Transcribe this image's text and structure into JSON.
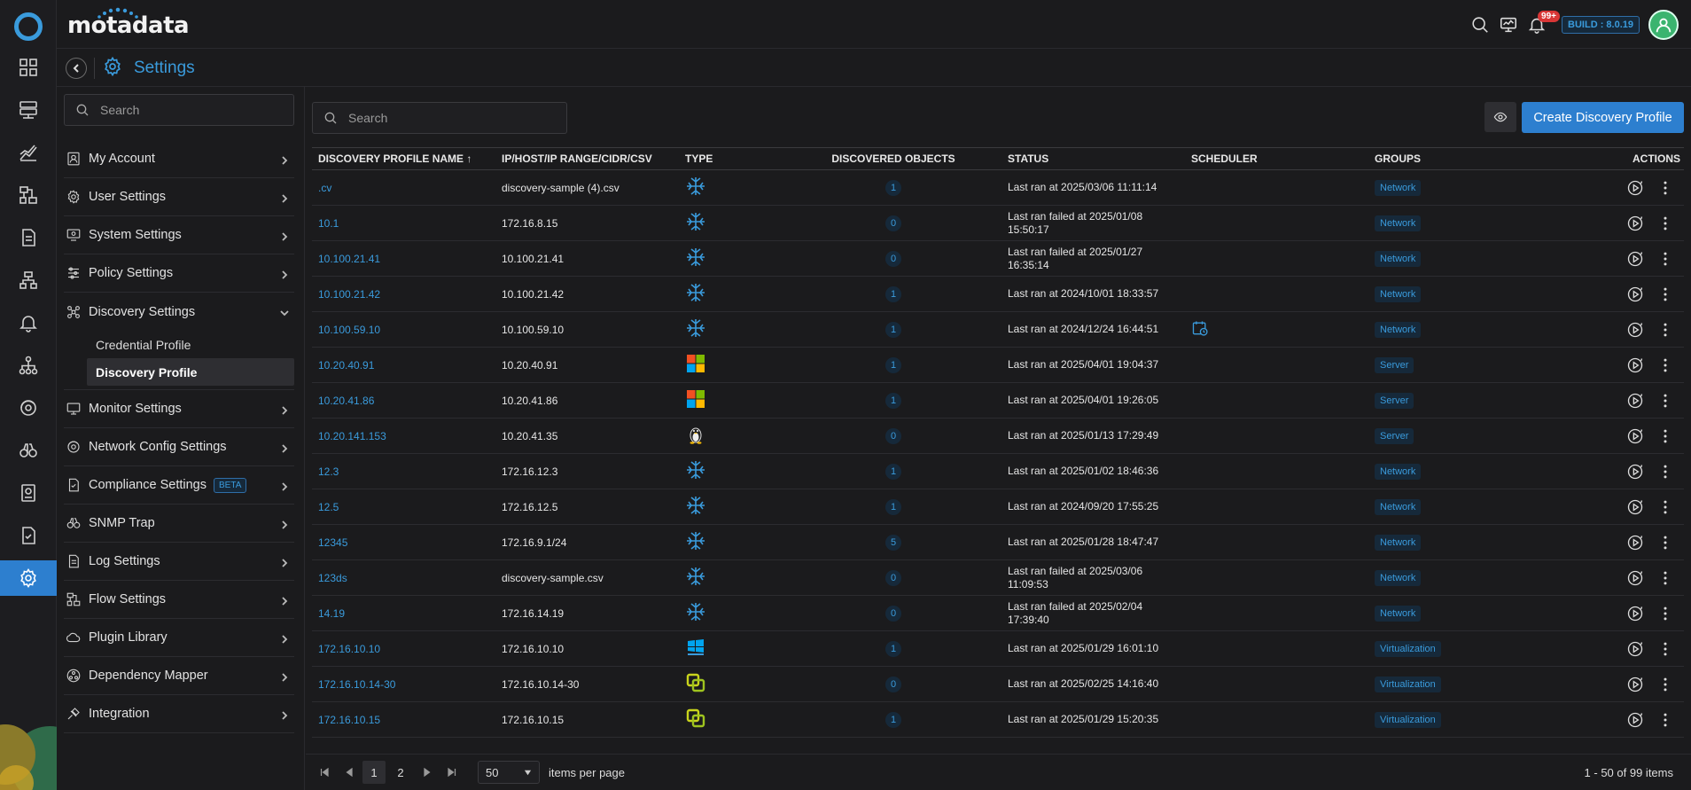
{
  "app": {
    "brand": "motadata",
    "build": "BUILD : 8.0.19",
    "notifications": "99+",
    "page_title": "Settings"
  },
  "rail": {
    "items": [
      "dashboard-icon",
      "server-icon",
      "metrics-icon",
      "topology-icon",
      "report-icon",
      "network-icon",
      "alert-icon",
      "hierarchy-icon",
      "config-icon",
      "binocular-icon",
      "audit-icon",
      "compliance-icon",
      "settings-icon"
    ],
    "active": "settings-icon"
  },
  "sidebar": {
    "search_placeholder": "Search",
    "items": [
      {
        "label": "My Account",
        "icon": "account-icon"
      },
      {
        "label": "User Settings",
        "icon": "user-settings-icon"
      },
      {
        "label": "System Settings",
        "icon": "system-settings-icon"
      },
      {
        "label": "Policy Settings",
        "icon": "policy-icon"
      },
      {
        "label": "Discovery Settings",
        "icon": "discovery-icon",
        "expanded": true,
        "children": [
          {
            "label": "Credential Profile"
          },
          {
            "label": "Discovery Profile",
            "active": true
          }
        ]
      },
      {
        "label": "Monitor Settings",
        "icon": "monitor-icon"
      },
      {
        "label": "Network Config Settings",
        "icon": "network-config-icon"
      },
      {
        "label": "Compliance Settings",
        "icon": "compliance-icon",
        "badge": "BETA"
      },
      {
        "label": "SNMP Trap",
        "icon": "binocular-icon"
      },
      {
        "label": "Log Settings",
        "icon": "log-icon"
      },
      {
        "label": "Flow Settings",
        "icon": "flow-icon"
      },
      {
        "label": "Plugin Library",
        "icon": "plugin-icon"
      },
      {
        "label": "Dependency Mapper",
        "icon": "dependency-icon"
      },
      {
        "label": "Integration",
        "icon": "integration-icon"
      }
    ]
  },
  "main": {
    "search_placeholder": "Search",
    "create_label": "Create Discovery Profile",
    "columns": [
      "DISCOVERY PROFILE NAME ↑",
      "IP/HOST/IP RANGE/CIDR/CSV",
      "TYPE",
      "DISCOVERED OBJECTS",
      "STATUS",
      "SCHEDULER",
      "GROUPS",
      "ACTIONS"
    ],
    "rows": [
      {
        "name": ".cv",
        "ip": "discovery-sample (4).csv",
        "type": "network",
        "objects": "1",
        "status": "Last ran at 2025/03/06 11:11:14",
        "scheduler": false,
        "group": "Network"
      },
      {
        "name": "10.1",
        "ip": "172.16.8.15",
        "type": "network",
        "objects": "0",
        "status": "Last ran failed at 2025/01/08 15:50:17",
        "scheduler": false,
        "group": "Network"
      },
      {
        "name": "10.100.21.41",
        "ip": "10.100.21.41",
        "type": "network",
        "objects": "0",
        "status": "Last ran failed at 2025/01/27 16:35:14",
        "scheduler": false,
        "group": "Network"
      },
      {
        "name": "10.100.21.42",
        "ip": "10.100.21.42",
        "type": "network",
        "objects": "1",
        "status": "Last ran at 2024/10/01 18:33:57",
        "scheduler": false,
        "group": "Network"
      },
      {
        "name": "10.100.59.10",
        "ip": "10.100.59.10",
        "type": "network",
        "objects": "1",
        "status": "Last ran at 2024/12/24 16:44:51",
        "scheduler": true,
        "group": "Network"
      },
      {
        "name": "10.20.40.91",
        "ip": "10.20.40.91",
        "type": "windows",
        "objects": "1",
        "status": "Last ran at 2025/04/01 19:04:37",
        "scheduler": false,
        "group": "Server"
      },
      {
        "name": "10.20.41.86",
        "ip": "10.20.41.86",
        "type": "windows",
        "objects": "1",
        "status": "Last ran at 2025/04/01 19:26:05",
        "scheduler": false,
        "group": "Server"
      },
      {
        "name": "10.20.141.153",
        "ip": "10.20.41.35",
        "type": "linux",
        "objects": "0",
        "status": "Last ran at 2025/01/13 17:29:49",
        "scheduler": false,
        "group": "Server"
      },
      {
        "name": "12.3",
        "ip": "172.16.12.3",
        "type": "network",
        "objects": "1",
        "status": "Last ran at 2025/01/02 18:46:36",
        "scheduler": false,
        "group": "Network"
      },
      {
        "name": "12.5",
        "ip": "172.16.12.5",
        "type": "network",
        "objects": "1",
        "status": "Last ran at 2024/09/20 17:55:25",
        "scheduler": false,
        "group": "Network"
      },
      {
        "name": "12345",
        "ip": "172.16.9.1/24",
        "type": "network",
        "objects": "5",
        "status": "Last ran at 2025/01/28 18:47:47",
        "scheduler": false,
        "group": "Network"
      },
      {
        "name": "123ds",
        "ip": "discovery-sample.csv",
        "type": "network",
        "objects": "0",
        "status": "Last ran failed at 2025/03/06 11:09:53",
        "scheduler": false,
        "group": "Network"
      },
      {
        "name": "14.19",
        "ip": "172.16.14.19",
        "type": "network",
        "objects": "0",
        "status": "Last ran failed at 2025/02/04 17:39:40",
        "scheduler": false,
        "group": "Network"
      },
      {
        "name": "172.16.10.10",
        "ip": "172.16.10.10",
        "type": "hyperv",
        "objects": "1",
        "status": "Last ran at 2025/01/29 16:01:10",
        "scheduler": false,
        "group": "Virtualization"
      },
      {
        "name": "172.16.10.14-30",
        "ip": "172.16.10.14-30",
        "type": "vmware",
        "objects": "0",
        "status": "Last ran at 2025/02/25 14:16:40",
        "scheduler": false,
        "group": "Virtualization"
      },
      {
        "name": "172.16.10.15",
        "ip": "172.16.10.15",
        "type": "vmware",
        "objects": "1",
        "status": "Last ran at 2025/01/29 15:20:35",
        "scheduler": false,
        "group": "Virtualization"
      }
    ],
    "pager": {
      "pages": [
        "1",
        "2"
      ],
      "current": "1",
      "page_size": "50",
      "items_label": "items per page",
      "range_label": "1 - 50 of 99 items"
    }
  }
}
